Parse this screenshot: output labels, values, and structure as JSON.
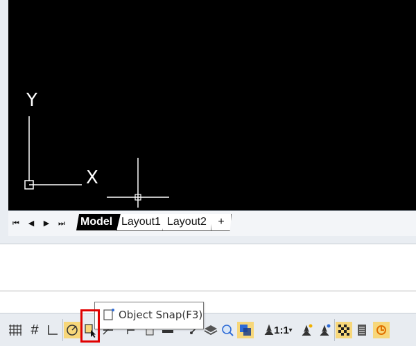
{
  "viewport": {
    "axis_x_label": "X",
    "axis_y_label": "Y",
    "background": "#000000"
  },
  "tabs": {
    "nav": [
      "first-icon",
      "prev-icon",
      "next-icon",
      "last-icon"
    ],
    "items": [
      {
        "label": "Model",
        "active": true
      },
      {
        "label": "Layout1",
        "active": false
      },
      {
        "label": "Layout2",
        "active": false
      },
      {
        "label": "+",
        "active": false
      }
    ]
  },
  "tooltip": {
    "text": "Object Snap(F3)"
  },
  "statusbar": {
    "scale_label": "1:1",
    "icons": [
      "grid-icon",
      "snap-icon",
      "ortho-icon",
      "polar-icon",
      "object-snap-icon",
      "otrack-icon",
      "ducs-icon",
      "dyn-icon",
      "lineweight-icon",
      "layers-icon",
      "quick-properties-icon",
      "selection-cycling-icon",
      "annotation-scale-icon",
      "annotation-visibility-icon",
      "auto-scale-icon",
      "hardware-accel-icon",
      "properties-icon",
      "clean-screen-icon"
    ]
  },
  "colors": {
    "highlight": "#e00000",
    "accent_orange": "#f0b000",
    "accent_blue": "#2e6bd6"
  }
}
